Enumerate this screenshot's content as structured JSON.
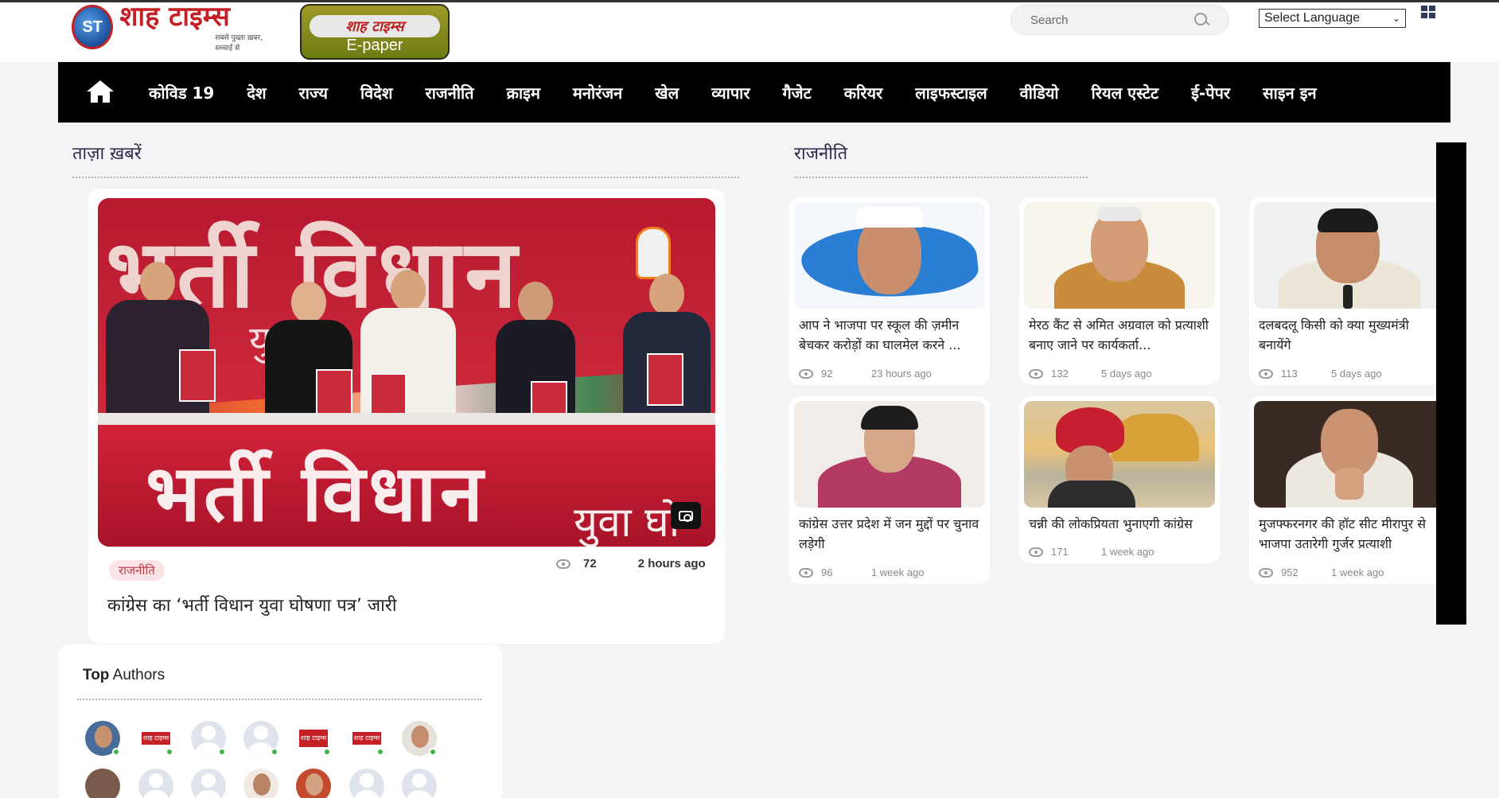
{
  "header": {
    "logo_text": "शाह टाइम्स",
    "logo_initials": "ST",
    "logo_tagline": "सबसे पुख्ता ख़बर, सच्चाई से",
    "epaper_masthead": "शाह टाइम्स",
    "epaper_label": "E-paper",
    "search_placeholder": "Search",
    "language_select": "Select Language"
  },
  "nav": {
    "items": [
      "कोविड 19",
      "देश",
      "राज्य",
      "विदेश",
      "राजनीति",
      "क्राइम",
      "मनोरंजन",
      "खेल",
      "व्यापार",
      "गैजेट",
      "करियर",
      "लाइफस्टाइल",
      "वीडियो",
      "रियल एस्टेट",
      "ई-पेपर",
      "साइन इन"
    ]
  },
  "latest": {
    "heading": "ताज़ा ख़बरें",
    "featured": {
      "banner_text": "भर्ती विधान",
      "banner_yuva": "युवा",
      "bottom_text": "भर्ती विधान",
      "bottom_yuva": "युवा घो",
      "category": "राजनीति",
      "views": "72",
      "time": "2 hours ago",
      "title": "कांग्रेस का ‘भर्ती विधान युवा घोषणा पत्र’ जारी"
    }
  },
  "politics": {
    "heading": "राजनीति",
    "cards": [
      {
        "title": "आप ने भाजपा पर स्कूल की ज़मीन बेचकर करोड़ों का घालमेल करने ...",
        "views": "92",
        "time": "23 hours ago"
      },
      {
        "title": "मेरठ कैंट से अमित अग्रवाल को प्रत्याशी बनाए जाने पर कार्यकर्ता...",
        "views": "132",
        "time": "5 days ago"
      },
      {
        "title": "दलबदलू किसी को क्या मुख्यमंत्री बनायेंगे",
        "views": "113",
        "time": "5 days ago"
      },
      {
        "title": "कांग्रेस उत्तर प्रदेश में जन मुद्दों पर चुनाव लड़ेगी",
        "views": "96",
        "time": "1 week ago"
      },
      {
        "title": "चन्नी की लोकप्रियता भुनाएगी कांग्रेस",
        "views": "171",
        "time": "1 week ago"
      },
      {
        "title": "मुजफ्फरनगर की हॉट सीट मीरापुर से भाजपा उतारेगी गुर्जर प्रत्याशी",
        "views": "952",
        "time": "1 week ago"
      }
    ]
  },
  "authors": {
    "heading_bold": "Top",
    "heading_rest": "Authors",
    "logo_avatar_text": "शाह टाइम्स"
  }
}
